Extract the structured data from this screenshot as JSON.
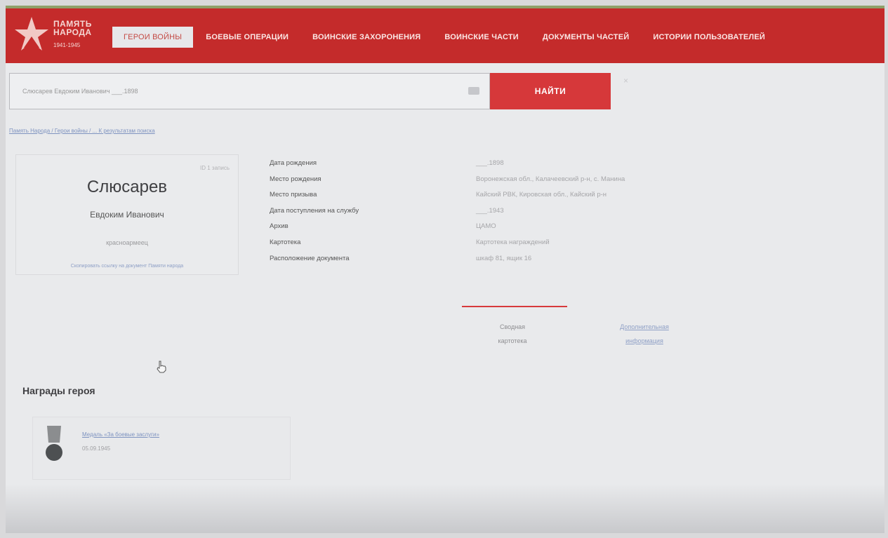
{
  "header": {
    "logo_line1": "ПАМЯТЬ",
    "logo_line2": "НАРОДА",
    "logo_years": "1941-1945",
    "nav": [
      {
        "label": "ГЕРОИ ВОЙНЫ",
        "active": true
      },
      {
        "label": "БОЕВЫЕ ОПЕРАЦИИ"
      },
      {
        "label": "ВОИНСКИЕ ЗАХОРОНЕНИЯ"
      },
      {
        "label": "ВОИНСКИЕ ЧАСТИ"
      },
      {
        "label": "ДОКУМЕНТЫ ЧАСТЕЙ"
      },
      {
        "label": "ИСТОРИИ ПОЛЬЗОВАТЕЛЕЙ"
      }
    ]
  },
  "search": {
    "value": "Слюсарев Евдоким Иванович ___.1898",
    "button_label": "НАЙТИ",
    "clear_label": "×"
  },
  "breadcrumb": "Память Народа / Герои войны / ... К результатам поиска",
  "card": {
    "record_label": "ID 1 запись",
    "surname": "Слюсарев",
    "name": "Евдоким Иванович",
    "rank": "красноармеец",
    "link": "Скопировать ссылку на документ Памяти народа"
  },
  "details": {
    "labels": [
      "Дата рождения",
      "Место рождения",
      "Место призыва",
      "Дата поступления на службу",
      "Архив",
      "Картотека",
      "Расположение документа"
    ],
    "values": [
      "___.1898",
      "Воронежская обл., Калачеевский р-н, с. Манина",
      "Кайский РВК, Кировская обл., Кайский р-н",
      "___.1943",
      "ЦАМО",
      "Картотека награждений",
      "шкаф 81, ящик 16"
    ]
  },
  "tabs": {
    "tab1_line1": "Сводная",
    "tab1_line2": "картотека",
    "tab2_line1": "Дополнительная",
    "tab2_line2": "информация"
  },
  "awards": {
    "title": "Награды героя",
    "items": [
      {
        "name": "Медаль «За боевые заслуги»",
        "date": "05.09.1945"
      }
    ]
  },
  "colors": {
    "header_red": "#c42b2b",
    "button_red": "#d6383a",
    "link_blue": "#7e93c0"
  }
}
